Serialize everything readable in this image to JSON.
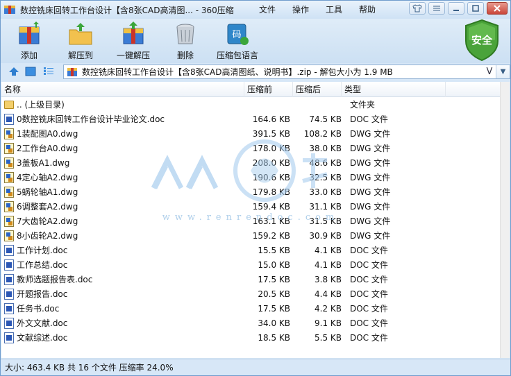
{
  "window": {
    "title": "数控铣床回转工作台设计【含8张CAD高清图... - 360压缩"
  },
  "menu": [
    "文件",
    "操作",
    "工具",
    "帮助"
  ],
  "toolbar": {
    "add": "添加",
    "extract_to": "解压到",
    "one_click": "一键解压",
    "delete": "删除",
    "lang": "压缩包语言"
  },
  "security": {
    "label": "安全"
  },
  "address": {
    "path": "数控铣床回转工作台设计【含8张CAD高清图纸、说明书】.zip - 解包大小为 1.9 MB"
  },
  "columns": {
    "name": "名称",
    "size": "压缩前",
    "packed": "压缩后",
    "type": "类型"
  },
  "files": [
    {
      "name": ".. (上级目录)",
      "size": "",
      "packed": "",
      "type": "文件夹",
      "icon": "folder"
    },
    {
      "name": "0数控铣床回转工作台设计毕业论文.doc",
      "size": "164.6 KB",
      "packed": "74.5 KB",
      "type": "DOC 文件",
      "icon": "doc"
    },
    {
      "name": "1装配图A0.dwg",
      "size": "391.5 KB",
      "packed": "108.2 KB",
      "type": "DWG 文件",
      "icon": "dwg"
    },
    {
      "name": "2工作台A0.dwg",
      "size": "178.0 KB",
      "packed": "38.0 KB",
      "type": "DWG 文件",
      "icon": "dwg"
    },
    {
      "name": "3盖板A1.dwg",
      "size": "208.0 KB",
      "packed": "48.6 KB",
      "type": "DWG 文件",
      "icon": "dwg"
    },
    {
      "name": "4定心轴A2.dwg",
      "size": "190.6 KB",
      "packed": "32.5 KB",
      "type": "DWG 文件",
      "icon": "dwg"
    },
    {
      "name": "5蜗轮轴A1.dwg",
      "size": "179.8 KB",
      "packed": "33.0 KB",
      "type": "DWG 文件",
      "icon": "dwg"
    },
    {
      "name": "6调整套A2.dwg",
      "size": "159.4 KB",
      "packed": "31.1 KB",
      "type": "DWG 文件",
      "icon": "dwg"
    },
    {
      "name": "7大齿轮A2.dwg",
      "size": "163.1 KB",
      "packed": "31.5 KB",
      "type": "DWG 文件",
      "icon": "dwg"
    },
    {
      "name": "8小齿轮A2.dwg",
      "size": "159.2 KB",
      "packed": "30.9 KB",
      "type": "DWG 文件",
      "icon": "dwg"
    },
    {
      "name": "工作计划.doc",
      "size": "15.5 KB",
      "packed": "4.1 KB",
      "type": "DOC 文件",
      "icon": "doc"
    },
    {
      "name": "工作总结.doc",
      "size": "15.0 KB",
      "packed": "4.1 KB",
      "type": "DOC 文件",
      "icon": "doc"
    },
    {
      "name": "教师选题报告表.doc",
      "size": "17.5 KB",
      "packed": "3.8 KB",
      "type": "DOC 文件",
      "icon": "doc"
    },
    {
      "name": "开题报告.doc",
      "size": "20.5 KB",
      "packed": "4.4 KB",
      "type": "DOC 文件",
      "icon": "doc"
    },
    {
      "name": "任务书.doc",
      "size": "17.5 KB",
      "packed": "4.2 KB",
      "type": "DOC 文件",
      "icon": "doc"
    },
    {
      "name": "外文文献.doc",
      "size": "34.0 KB",
      "packed": "9.1 KB",
      "type": "DOC 文件",
      "icon": "doc"
    },
    {
      "name": "文献综述.doc",
      "size": "18.5 KB",
      "packed": "5.5 KB",
      "type": "DOC 文件",
      "icon": "doc"
    }
  ],
  "watermark": {
    "text": "www.renrendoc.com"
  },
  "status": {
    "text": "大小: 463.4 KB 共 16 个文件 压缩率 24.0%"
  }
}
